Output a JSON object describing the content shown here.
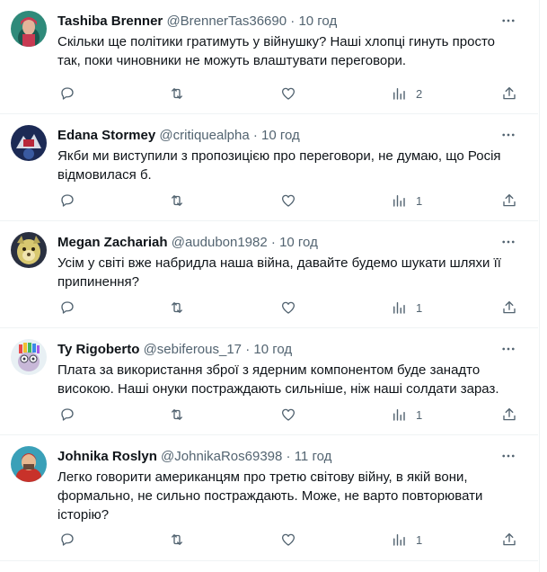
{
  "tweets": [
    {
      "name": "Tashiba Brenner",
      "handle": "@BrennerTas36690",
      "sep": " · ",
      "time": "10 год",
      "text": "Скільки ще політики гратимуть у війнушку? Наші хлопці гинуть просто так, поки чиновники не можуть влаштувати переговори.",
      "views": "2",
      "avatar_colors": [
        "#2f8a7a",
        "#c83a52"
      ]
    },
    {
      "name": "Edana Stormey",
      "handle": "@critiquealpha",
      "sep": " · ",
      "time": "10 год",
      "text": "Якби ми виступили з пропозицією про переговори, не думаю, що Росія відмовилася б.",
      "views": "1",
      "avatar_colors": [
        "#1c2a55",
        "#d8dce6"
      ]
    },
    {
      "name": "Megan Zachariah",
      "handle": "@audubon1982",
      "sep": " · ",
      "time": "10 год",
      "text": "Усім у світі вже набридла наша війна, давайте будемо шукати шляхи її припинення?",
      "views": "1",
      "avatar_colors": [
        "#d8c870",
        "#5a4a2a"
      ]
    },
    {
      "name": "Ty Rigoberto",
      "handle": "@sebiferous_17",
      "sep": " · ",
      "time": "10 год",
      "text": "Плата за використання зброї з ядерним компонентом буде занадто високою. Наші онуки постраждають сильніше, ніж наші солдати зараз.",
      "views": "1",
      "avatar_colors": [
        "#e8f0f4",
        "#8a7a9a"
      ]
    },
    {
      "name": "Johnika Roslyn",
      "handle": "@JohnikaRos69398",
      "sep": " · ",
      "time": "11 год",
      "text": "Легко говорити американцям про третю світову війну, в якій вони, формально, не сильно постраждають. Може, не варто повторювати історію?",
      "views": "1",
      "avatar_colors": [
        "#3aa0b8",
        "#c8322a"
      ]
    }
  ],
  "colors": {
    "text": "#0f1419",
    "muted": "#536471",
    "divider": "#eff3f4"
  }
}
